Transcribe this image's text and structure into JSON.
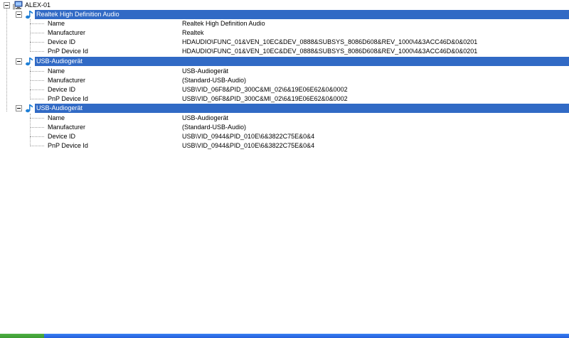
{
  "tree": {
    "root": {
      "label": "ALEX-01",
      "icon": "computer-icon"
    },
    "devices": [
      {
        "label": "Realtek High Definition Audio",
        "icon": "music-note-icon",
        "properties": [
          {
            "name": "Name",
            "value": "Realtek High Definition Audio"
          },
          {
            "name": "Manufacturer",
            "value": "Realtek"
          },
          {
            "name": "Device ID",
            "value": "HDAUDIO\\FUNC_01&VEN_10EC&DEV_0888&SUBSYS_8086D608&REV_1000\\4&3ACC46D&0&0201"
          },
          {
            "name": "PnP Device Id",
            "value": "HDAUDIO\\FUNC_01&VEN_10EC&DEV_0888&SUBSYS_8086D608&REV_1000\\4&3ACC46D&0&0201"
          }
        ]
      },
      {
        "label": "USB-Audiogerät",
        "icon": "music-note-icon",
        "properties": [
          {
            "name": "Name",
            "value": "USB-Audiogerät"
          },
          {
            "name": "Manufacturer",
            "value": "(Standard-USB-Audio)"
          },
          {
            "name": "Device ID",
            "value": "USB\\VID_06F8&PID_300C&MI_02\\6&19E06E62&0&0002"
          },
          {
            "name": "PnP Device Id",
            "value": "USB\\VID_06F8&PID_300C&MI_02\\6&19E06E62&0&0002"
          }
        ]
      },
      {
        "label": "USB-Audiogerät",
        "icon": "music-note-icon",
        "properties": [
          {
            "name": "Name",
            "value": "USB-Audiogerät"
          },
          {
            "name": "Manufacturer",
            "value": "(Standard-USB-Audio)"
          },
          {
            "name": "Device ID",
            "value": "USB\\VID_0944&PID_010E\\6&3822C75E&0&4"
          },
          {
            "name": "PnP Device Id",
            "value": "USB\\VID_0944&PID_010E\\6&3822C75E&0&4"
          }
        ]
      }
    ]
  },
  "colors": {
    "selection": "#316ac5",
    "selection_text": "#ffffff",
    "note_icon": "#1f7fd6",
    "tree_lines": "#a0a0a0",
    "taskbar": "#245edb",
    "start_button": "#3c9a32"
  }
}
